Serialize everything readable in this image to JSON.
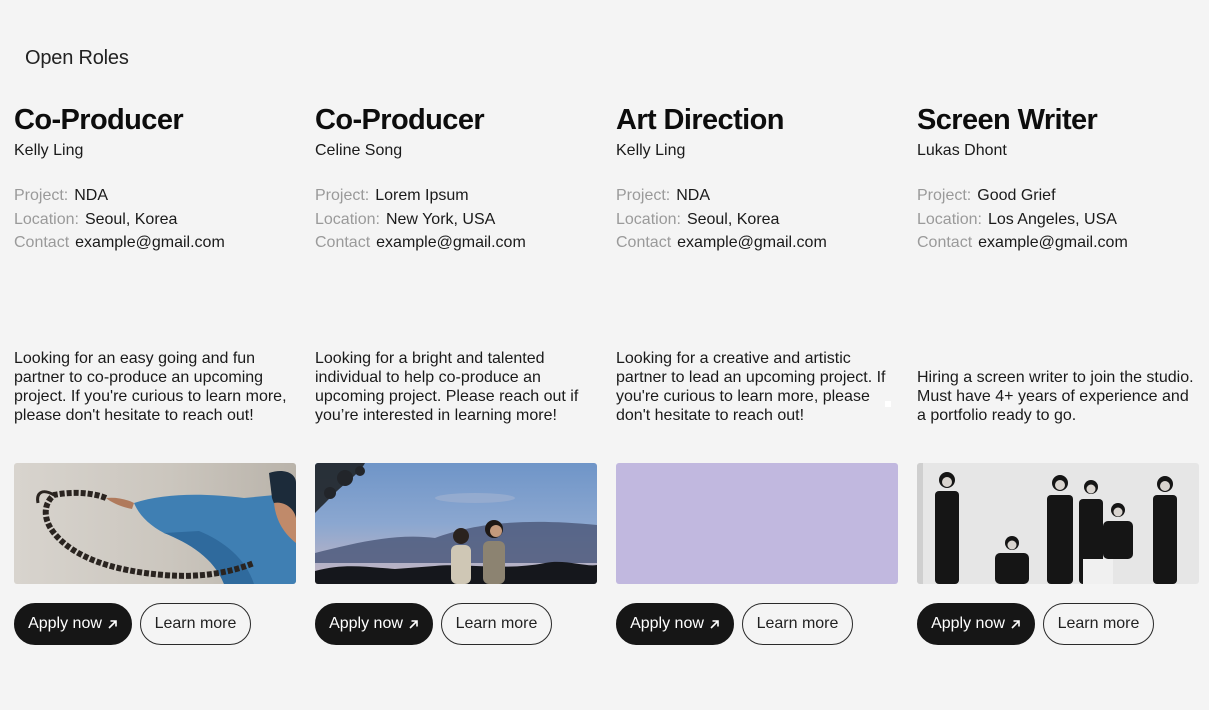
{
  "page": {
    "title": "Open Roles"
  },
  "roles": [
    {
      "title": "Co-Producer",
      "person": "Kelly Ling",
      "project_label": "Project:",
      "project": "NDA",
      "location_label": "Location:",
      "location": "Seoul, Korea",
      "contact_label": "Contact",
      "contact": "example@gmail.com",
      "description": "Looking for an easy going and fun partner to co-produce an upcoming project. If you're curious to learn more, please don't hesitate to reach out!",
      "apply_label": "Apply now",
      "learn_label": "Learn more"
    },
    {
      "title": "Co-Producer",
      "person": "Celine Song",
      "project_label": "Project:",
      "project": "Lorem Ipsum",
      "location_label": "Location:",
      "location": "New York, USA",
      "contact_label": "Contact",
      "contact": "example@gmail.com",
      "description": "Looking for a bright and talented individual to help co-produce an upcoming project. Please reach out if you’re interested in learning more!",
      "apply_label": "Apply now",
      "learn_label": "Learn more"
    },
    {
      "title": "Art Direction",
      "person": "Kelly Ling",
      "project_label": "Project:",
      "project": "NDA",
      "location_label": "Location:",
      "location": "Seoul, Korea",
      "contact_label": "Contact",
      "contact": "example@gmail.com",
      "description": "Looking for a creative and artistic partner to lead an upcoming project. If you're curious to learn more, please don't hesitate to reach out!",
      "apply_label": "Apply now",
      "learn_label": "Learn more"
    },
    {
      "title": "Screen Writer",
      "person": "Lukas Dhont",
      "project_label": "Project:",
      "project": "Good Grief",
      "location_label": "Location:",
      "location": "Los Angeles, USA",
      "contact_label": "Contact",
      "contact": "example@gmail.com",
      "description": "Hiring a screen writer to join the studio. Must have 4+ years of experience and a portfolio ready to go.",
      "apply_label": "Apply now",
      "learn_label": "Learn more"
    }
  ],
  "colors": {
    "background": "#f4f4f4",
    "primary_button": "#161616",
    "placeholder_lavender": "#c1b8df"
  },
  "icons": {
    "apply_arrow": "arrow-up-right-icon"
  }
}
